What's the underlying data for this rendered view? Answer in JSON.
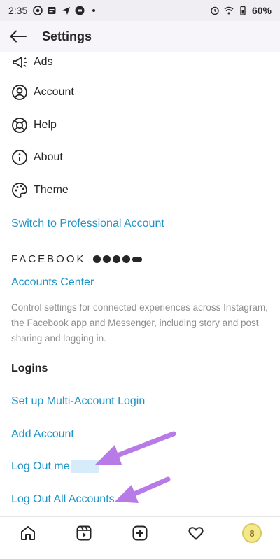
{
  "status_bar": {
    "time": "2:35",
    "battery": "60%"
  },
  "header": {
    "title": "Settings"
  },
  "menu": {
    "ads": "Ads",
    "account": "Account",
    "help": "Help",
    "about": "About",
    "theme": "Theme"
  },
  "switch_professional": "Switch to Professional Account",
  "facebook_section": {
    "heading": "FACEBOOK",
    "accounts_center": "Accounts Center",
    "description": "Control settings for connected experiences across Instagram, the Facebook app and Messenger, including story and post sharing and logging in."
  },
  "logins": {
    "heading": "Logins",
    "multi_account": "Set up Multi-Account Login",
    "add_account": "Add Account",
    "log_out_user": "Log Out me",
    "log_out_all": "Log Out All Accounts"
  },
  "colors": {
    "link": "#1e93c8",
    "annotation_arrow": "#b77ae6"
  },
  "avatar": {
    "label": "8"
  }
}
